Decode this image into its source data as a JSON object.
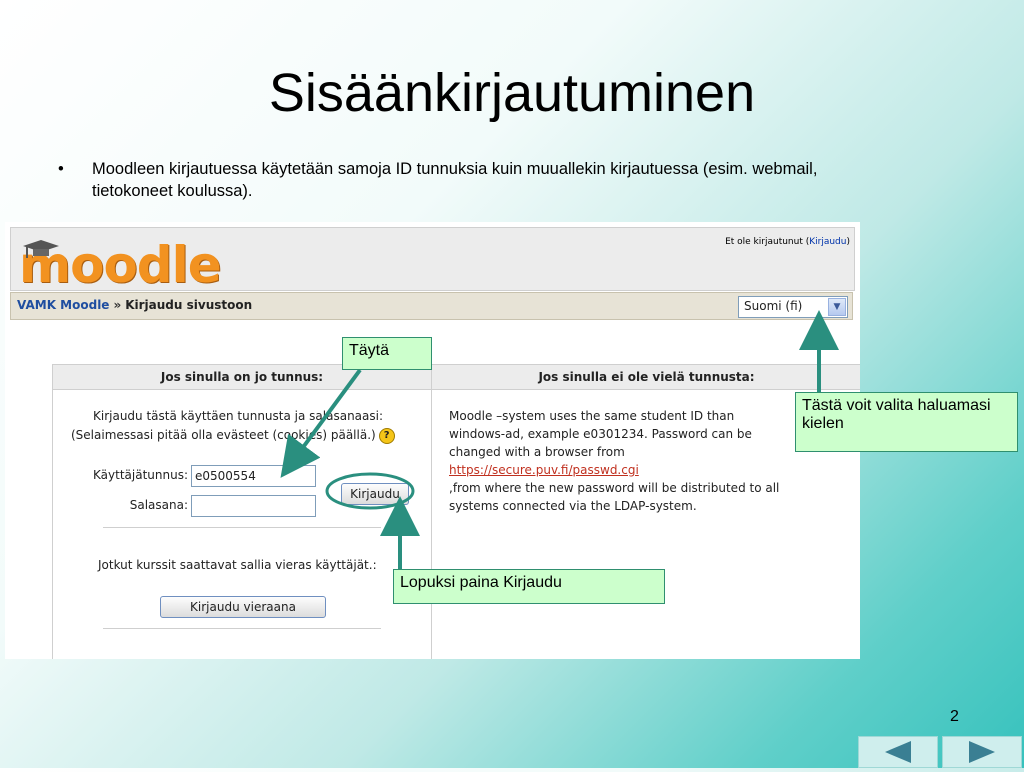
{
  "slide": {
    "title": "Sisäänkirjautuminen",
    "bullet_mark": "•",
    "bullet": "Moodleen kirjautuessa käytetään samoja ID tunnuksia kuin muuallekin kirjautuessa (esim. webmail, tietokoneet koulussa).",
    "page_number": "2"
  },
  "moodle": {
    "logo_text": "moodle",
    "login_status": "Et ole kirjautunut (",
    "login_link": "Kirjaudu",
    "login_status_end": ")",
    "breadcrumb_home": "VAMK Moodle",
    "breadcrumb_sep": "»",
    "breadcrumb_current": "Kirjaudu sivustoon",
    "language_value": "Suomi (fi)",
    "left_heading": "Jos sinulla on jo tunnus:",
    "right_heading": "Jos sinulla ei ole vielä tunnusta:",
    "left_line1": "Kirjaudu tästä käyttäen tunnusta ja salasanaasi:",
    "left_line2": "(Selaimessasi pitää olla evästeet (cookies) päällä.)",
    "help_symbol": "?",
    "username_label": "Käyttäjätunnus:",
    "username_value": "e0500554",
    "password_label": "Salasana:",
    "password_value": "",
    "login_button": "Kirjaudu",
    "guest_text": "Jotkut kurssit saattavat sallia vieras käyttäjät.:",
    "guest_button": "Kirjaudu vieraana",
    "right_line1": "Moodle –system uses the same student ID than",
    "right_line2": "windows-ad, example e0301234. Password can be",
    "right_line3": "changed with a browser from",
    "right_link": "https://secure.puv.fi/passwd.cgi",
    "right_line4": ",from where the new password will be distributed to all",
    "right_line5": "systems connected via the LDAP-system."
  },
  "callouts": {
    "fill": "Täytä",
    "language": "Tästä voit valita haluamasi kielen",
    "finally": "Lopuksi paina Kirjaudu"
  },
  "colors": {
    "accent": "#2a8f7f",
    "callout_bg": "#ccffcc",
    "logo": "#f29220",
    "link": "#c0301f"
  },
  "nav": {
    "prev_icon": "triangle-left-icon",
    "next_icon": "triangle-right-icon"
  }
}
